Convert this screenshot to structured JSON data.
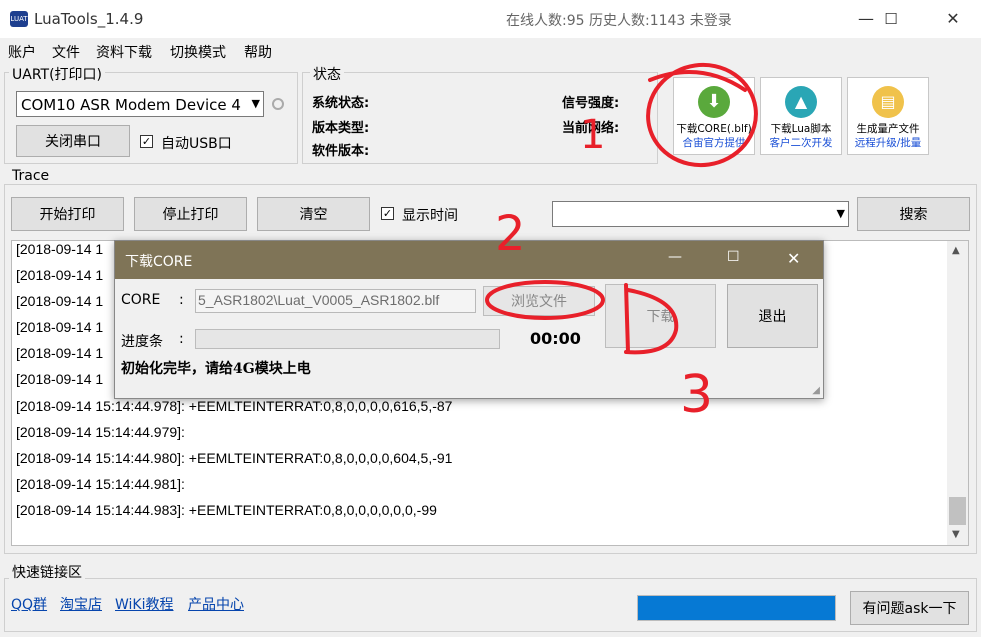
{
  "window": {
    "title": "LuaTools_1.4.9",
    "status": "在线人数:95 历史人数:1143 未登录",
    "logo_text": "LUAT",
    "min": "—",
    "max": "☐",
    "close": "✕"
  },
  "menu": [
    "账户",
    "文件",
    "资料下载",
    "切换模式",
    "帮助"
  ],
  "uart": {
    "group_label": "UART(打印口)",
    "port_value": "COM10 ASR Modem Device 4",
    "close_port": "关闭串口",
    "auto_usb": "自动USB口"
  },
  "status": {
    "group_label": "状态",
    "system_status": "系统状态:",
    "version_type": "版本类型:",
    "software_version": "软件版本:",
    "signal": "信号强度:",
    "network": "当前网络:"
  },
  "tools": [
    {
      "title": "下载CORE(.blf)",
      "sub": "合宙官方提供",
      "icon": "download-arrow-icon",
      "color": "#5aa93c"
    },
    {
      "title": "下载Lua脚本",
      "sub": "客户二次开发",
      "icon": "lua-script-icon",
      "color": "#2aa6b5"
    },
    {
      "title": "生成量产文件",
      "sub": "远程升级/批量",
      "icon": "document-icon",
      "color": "#f0c24b"
    }
  ],
  "trace": {
    "group_label": "Trace",
    "start": "开始打印",
    "stop": "停止打印",
    "clear": "清空",
    "show_time": "显示时间",
    "search": "搜索",
    "log_lines": [
      "[2018-09-14 1",
      "[2018-09-14 1",
      "[2018-09-14 1",
      "[2018-09-14 1",
      "[2018-09-14 1",
      "[2018-09-14 1",
      "[2018-09-14 15:14:44.978]: +EEMLTEINTERRAT:0,8,0,0,0,0,616,5,-87",
      "[2018-09-14 15:14:44.979]:",
      "[2018-09-14 15:14:44.980]: +EEMLTEINTERRAT:0,8,0,0,0,0,604,5,-91",
      "[2018-09-14 15:14:44.981]:",
      "[2018-09-14 15:14:44.983]: +EEMLTEINTERRAT:0,8,0,0,0,0,0,0,-99"
    ]
  },
  "dialog": {
    "title": "下载CORE",
    "core_label": "CORE",
    "colon": ":",
    "core_path": "5_ASR1802\\Luat_V0005_ASR1802.blf",
    "browse": "浏览文件",
    "progress_label": "进度条",
    "time": "00:00",
    "download": "下载",
    "exit": "退出",
    "message": "初始化完毕，请给4G模块上电",
    "progress": 0
  },
  "quicklinks": {
    "group_label": "快速链接区",
    "links": [
      "QQ群",
      "淘宝店",
      "WiKi教程",
      "产品中心"
    ],
    "ask": "有问题ask一下",
    "bar_fill": 1.0
  },
  "annotations": [
    "1",
    "2",
    "3"
  ]
}
